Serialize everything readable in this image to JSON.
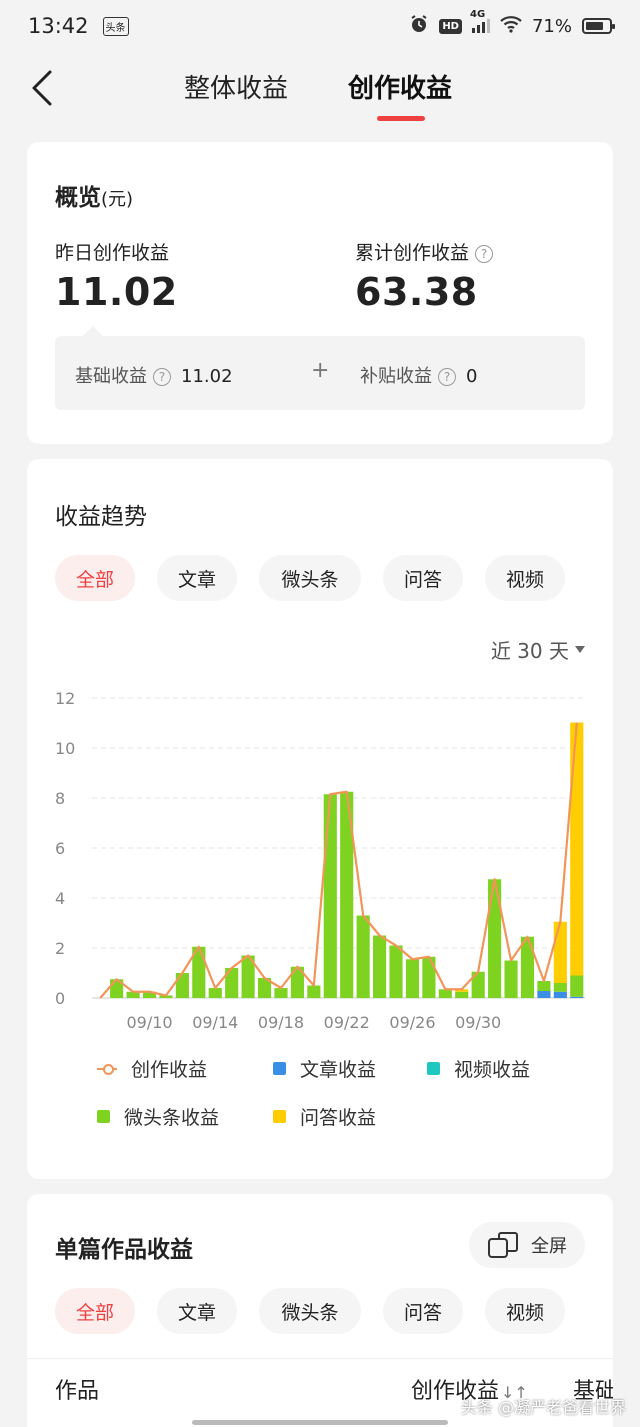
{
  "status_bar": {
    "time": "13:42",
    "app_badge": "头条",
    "hd": "HD",
    "network": "4G",
    "battery": "71%"
  },
  "nav": {
    "tab_overall": "整体收益",
    "tab_creation": "创作收益"
  },
  "overview": {
    "title": "概览",
    "unit": "(元)",
    "yesterday_label": "昨日创作收益",
    "yesterday_value": "11.02",
    "total_label": "累计创作收益",
    "total_value": "63.38",
    "basic_label": "基础收益",
    "basic_value": "11.02",
    "plus": "+",
    "subsidy_label": "补贴收益",
    "subsidy_value": "0",
    "help_glyph": "?"
  },
  "trend": {
    "title": "收益趋势",
    "chips": [
      "全部",
      "文章",
      "微头条",
      "问答",
      "视频"
    ],
    "range": "近 30 天"
  },
  "chart_data": {
    "type": "bar",
    "title": "",
    "x_ticks": [
      "09/10",
      "09/14",
      "09/18",
      "09/22",
      "09/26",
      "09/30"
    ],
    "ylim": [
      0,
      12
    ],
    "y_ticks": [
      0,
      2,
      4,
      6,
      8,
      10,
      12
    ],
    "grid": true,
    "legend_position": "bottom",
    "categories": [
      "09/07",
      "09/08",
      "09/09",
      "09/10",
      "09/11",
      "09/12",
      "09/13",
      "09/14",
      "09/15",
      "09/16",
      "09/17",
      "09/18",
      "09/19",
      "09/20",
      "09/21",
      "09/22",
      "09/23",
      "09/24",
      "09/25",
      "09/26",
      "09/27",
      "09/28",
      "09/29",
      "09/30",
      "10/01",
      "10/02",
      "10/03",
      "10/04",
      "10/05",
      "10/06"
    ],
    "series": [
      {
        "name": "文章收益",
        "color": "#3a8ee6",
        "values": [
          0,
          0,
          0,
          0,
          0,
          0,
          0,
          0,
          0,
          0,
          0,
          0,
          0,
          0,
          0,
          0,
          0,
          0,
          0,
          0,
          0,
          0,
          0,
          0,
          0,
          0,
          0,
          0.28,
          0.25,
          0.05
        ]
      },
      {
        "name": "视频收益",
        "color": "#1ec8c0",
        "values": [
          0,
          0,
          0,
          0,
          0,
          0,
          0,
          0,
          0,
          0,
          0,
          0,
          0,
          0,
          0,
          0,
          0,
          0,
          0,
          0,
          0,
          0,
          0,
          0,
          0,
          0,
          0,
          0,
          0,
          0
        ]
      },
      {
        "name": "微头条收益",
        "color": "#7ed321",
        "values": [
          0,
          0.75,
          0.25,
          0.25,
          0.1,
          1.0,
          2.05,
          0.4,
          1.2,
          1.7,
          0.8,
          0.4,
          1.25,
          0.5,
          8.15,
          8.25,
          3.3,
          2.5,
          2.1,
          1.55,
          1.65,
          0.35,
          0.25,
          1.05,
          4.75,
          1.5,
          2.45,
          0.4,
          0.35,
          0.85
        ]
      },
      {
        "name": "问答收益",
        "color": "#ffcd00",
        "values": [
          0,
          0,
          0,
          0,
          0,
          0,
          0,
          0,
          0,
          0,
          0,
          0,
          0,
          0,
          0,
          0,
          0,
          0,
          0,
          0,
          0,
          0,
          0.1,
          0,
          0,
          0,
          0,
          0,
          2.45,
          10.12
        ]
      },
      {
        "name": "创作收益",
        "color": "#f2955a",
        "type": "line",
        "values": [
          0,
          0.75,
          0.25,
          0.25,
          0.1,
          1.0,
          2.05,
          0.4,
          1.2,
          1.7,
          0.8,
          0.4,
          1.25,
          0.5,
          8.15,
          8.25,
          3.3,
          2.5,
          2.1,
          1.55,
          1.65,
          0.35,
          0.35,
          1.05,
          4.75,
          1.5,
          2.45,
          0.68,
          3.05,
          11.02
        ]
      }
    ]
  },
  "legend": [
    {
      "label": "创作收益",
      "kind": "line",
      "color": "#f2955a"
    },
    {
      "label": "文章收益",
      "kind": "square",
      "color": "#3a8ee6"
    },
    {
      "label": "视频收益",
      "kind": "square",
      "color": "#1ec8c0"
    },
    {
      "label": "微头条收益",
      "kind": "square",
      "color": "#7ed321"
    },
    {
      "label": "问答收益",
      "kind": "square",
      "color": "#ffcd00"
    }
  ],
  "works": {
    "title": "单篇作品收益",
    "fullscreen_label": "全屏",
    "chips": [
      "全部",
      "文章",
      "微头条",
      "问答",
      "视频"
    ],
    "col_work": "作品",
    "col_creation": "创作收益",
    "col_basic": "基础",
    "sort_glyph": "↓↑"
  },
  "watermark": "头条 @凝严老爸看世界",
  "colors": {
    "accent": "#f04142",
    "chip_active_bg": "#fdeeee"
  }
}
